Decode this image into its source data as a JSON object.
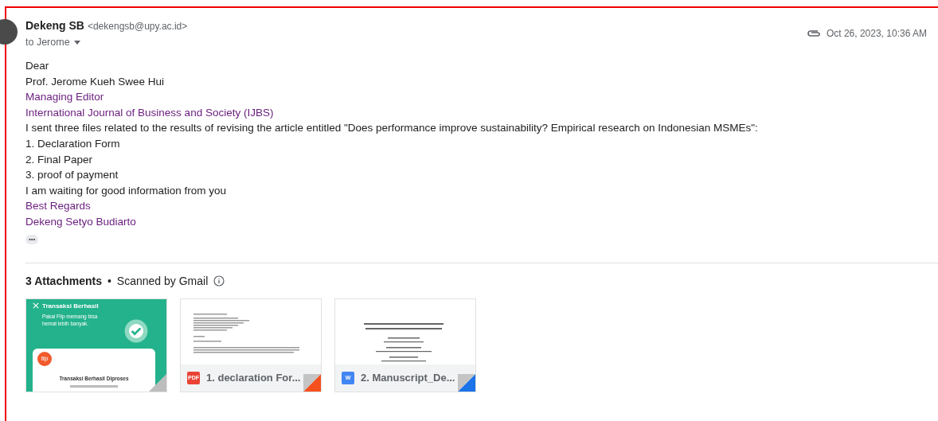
{
  "sender": {
    "name": "Dekeng SB",
    "email": "<dekengsb@upy.ac.id>",
    "recipient": "to Jerome",
    "date": "Oct 26, 2023, 10:36 AM"
  },
  "body": [
    {
      "text": "Dear",
      "kind": "plain"
    },
    {
      "text": "Prof. Jerome Kueh Swee Hui",
      "kind": "plain"
    },
    {
      "text": "Managing Editor",
      "kind": "link"
    },
    {
      "text": "International Journal of Business and Society (IJBS)",
      "kind": "link"
    },
    {
      "text": "I sent three files related to the results of revising the article entitled \"Does performance improve sustainability? Empirical research on Indonesian MSMEs\":",
      "kind": "plain"
    },
    {
      "text": "1. Declaration Form",
      "kind": "plain"
    },
    {
      "text": "2. Final Paper",
      "kind": "plain"
    },
    {
      "text": "3. proof of payment",
      "kind": "plain"
    },
    {
      "text": "I am waiting for good information from you",
      "kind": "plain"
    },
    {
      "text": "Best Regards",
      "kind": "link"
    },
    {
      "text": "Dekeng Setyo Budiarto",
      "kind": "link"
    }
  ],
  "more_button": "•••",
  "attachments_header": {
    "count": "3 Attachments",
    "separator": "•",
    "scan_note": "Scanned by Gmail"
  },
  "attachments": [
    {
      "kind": "image",
      "preview": {
        "title": "Transaksi Berhasil",
        "subtitle": "Pakai Flip memang bisa hemat lebih banyak.",
        "logo": "flip",
        "status": "Transaksi Berhasil Diproses"
      }
    },
    {
      "kind": "pdf",
      "badge": "PDF",
      "name": "1. declaration For..."
    },
    {
      "kind": "word",
      "badge": "W",
      "name": "2. Manuscript_De..."
    }
  ]
}
